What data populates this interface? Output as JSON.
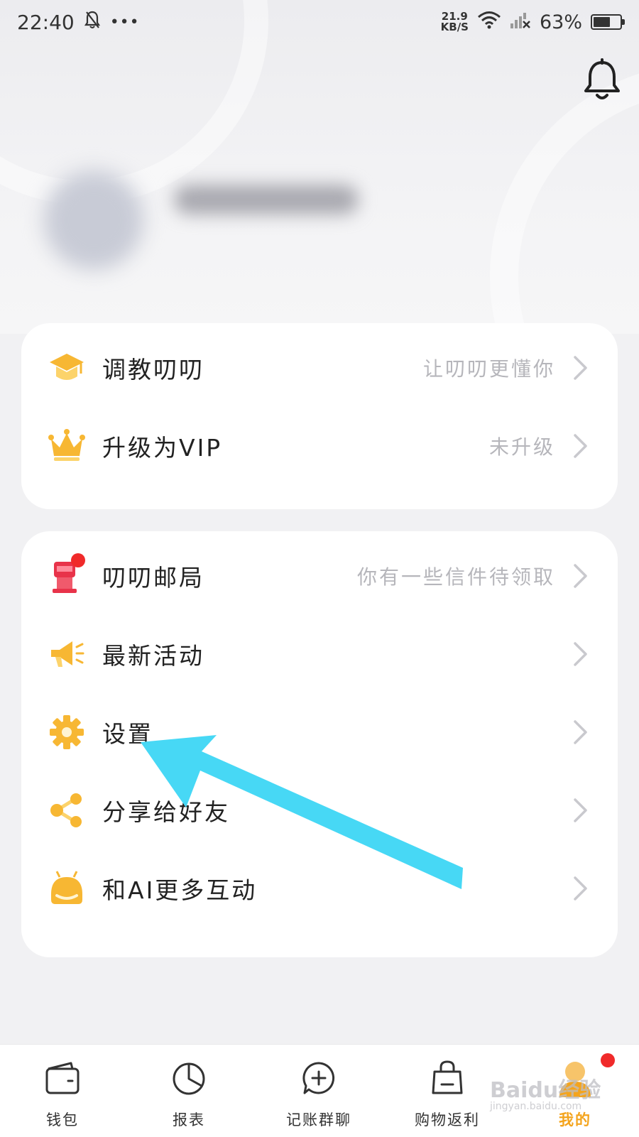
{
  "status_bar": {
    "time": "22:40",
    "more": "•••",
    "net_speed_value": "21.9",
    "net_speed_unit": "KB/S",
    "battery": "63%",
    "battery_level": 0.63
  },
  "menu_card_1": [
    {
      "label": "调教叨叨",
      "value": "让叨叨更懂你",
      "icon": "graduation-cap-icon"
    },
    {
      "label": "升级为VIP",
      "value": "未升级",
      "icon": "crown-icon"
    }
  ],
  "menu_card_2": [
    {
      "label": "叨叨邮局",
      "value": "你有一些信件待领取",
      "icon": "mailbox-icon"
    },
    {
      "label": "最新活动",
      "value": "",
      "icon": "megaphone-icon"
    },
    {
      "label": "设置",
      "value": "",
      "icon": "gear-icon"
    },
    {
      "label": "分享给好友",
      "value": "",
      "icon": "share-icon"
    },
    {
      "label": "和AI更多互动",
      "value": "",
      "icon": "robot-icon"
    }
  ],
  "tab_bar": [
    {
      "label": "钱包",
      "icon": "wallet-icon"
    },
    {
      "label": "报表",
      "icon": "pie-chart-icon"
    },
    {
      "label": "记账群聊",
      "icon": "chat-add-icon"
    },
    {
      "label": "购物返利",
      "icon": "shopping-bag-icon"
    },
    {
      "label": "我的",
      "icon": "profile-icon"
    }
  ],
  "colors": {
    "accent": "#f4a41d",
    "annotation_arrow": "#47d8f5",
    "badge": "#f02a2a"
  },
  "watermark": {
    "brand": "Baidu经验",
    "sub": "jingyan.baidu.com"
  }
}
